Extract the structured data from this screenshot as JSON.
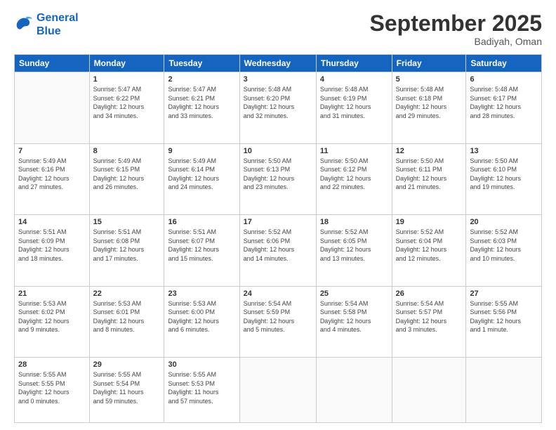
{
  "logo": {
    "line1": "General",
    "line2": "Blue"
  },
  "title": "September 2025",
  "subtitle": "Badiyah, Oman",
  "days_of_week": [
    "Sunday",
    "Monday",
    "Tuesday",
    "Wednesday",
    "Thursday",
    "Friday",
    "Saturday"
  ],
  "weeks": [
    [
      {
        "num": "",
        "info": ""
      },
      {
        "num": "1",
        "info": "Sunrise: 5:47 AM\nSunset: 6:22 PM\nDaylight: 12 hours\nand 34 minutes."
      },
      {
        "num": "2",
        "info": "Sunrise: 5:47 AM\nSunset: 6:21 PM\nDaylight: 12 hours\nand 33 minutes."
      },
      {
        "num": "3",
        "info": "Sunrise: 5:48 AM\nSunset: 6:20 PM\nDaylight: 12 hours\nand 32 minutes."
      },
      {
        "num": "4",
        "info": "Sunrise: 5:48 AM\nSunset: 6:19 PM\nDaylight: 12 hours\nand 31 minutes."
      },
      {
        "num": "5",
        "info": "Sunrise: 5:48 AM\nSunset: 6:18 PM\nDaylight: 12 hours\nand 29 minutes."
      },
      {
        "num": "6",
        "info": "Sunrise: 5:48 AM\nSunset: 6:17 PM\nDaylight: 12 hours\nand 28 minutes."
      }
    ],
    [
      {
        "num": "7",
        "info": "Sunrise: 5:49 AM\nSunset: 6:16 PM\nDaylight: 12 hours\nand 27 minutes."
      },
      {
        "num": "8",
        "info": "Sunrise: 5:49 AM\nSunset: 6:15 PM\nDaylight: 12 hours\nand 26 minutes."
      },
      {
        "num": "9",
        "info": "Sunrise: 5:49 AM\nSunset: 6:14 PM\nDaylight: 12 hours\nand 24 minutes."
      },
      {
        "num": "10",
        "info": "Sunrise: 5:50 AM\nSunset: 6:13 PM\nDaylight: 12 hours\nand 23 minutes."
      },
      {
        "num": "11",
        "info": "Sunrise: 5:50 AM\nSunset: 6:12 PM\nDaylight: 12 hours\nand 22 minutes."
      },
      {
        "num": "12",
        "info": "Sunrise: 5:50 AM\nSunset: 6:11 PM\nDaylight: 12 hours\nand 21 minutes."
      },
      {
        "num": "13",
        "info": "Sunrise: 5:50 AM\nSunset: 6:10 PM\nDaylight: 12 hours\nand 19 minutes."
      }
    ],
    [
      {
        "num": "14",
        "info": "Sunrise: 5:51 AM\nSunset: 6:09 PM\nDaylight: 12 hours\nand 18 minutes."
      },
      {
        "num": "15",
        "info": "Sunrise: 5:51 AM\nSunset: 6:08 PM\nDaylight: 12 hours\nand 17 minutes."
      },
      {
        "num": "16",
        "info": "Sunrise: 5:51 AM\nSunset: 6:07 PM\nDaylight: 12 hours\nand 15 minutes."
      },
      {
        "num": "17",
        "info": "Sunrise: 5:52 AM\nSunset: 6:06 PM\nDaylight: 12 hours\nand 14 minutes."
      },
      {
        "num": "18",
        "info": "Sunrise: 5:52 AM\nSunset: 6:05 PM\nDaylight: 12 hours\nand 13 minutes."
      },
      {
        "num": "19",
        "info": "Sunrise: 5:52 AM\nSunset: 6:04 PM\nDaylight: 12 hours\nand 12 minutes."
      },
      {
        "num": "20",
        "info": "Sunrise: 5:52 AM\nSunset: 6:03 PM\nDaylight: 12 hours\nand 10 minutes."
      }
    ],
    [
      {
        "num": "21",
        "info": "Sunrise: 5:53 AM\nSunset: 6:02 PM\nDaylight: 12 hours\nand 9 minutes."
      },
      {
        "num": "22",
        "info": "Sunrise: 5:53 AM\nSunset: 6:01 PM\nDaylight: 12 hours\nand 8 minutes."
      },
      {
        "num": "23",
        "info": "Sunrise: 5:53 AM\nSunset: 6:00 PM\nDaylight: 12 hours\nand 6 minutes."
      },
      {
        "num": "24",
        "info": "Sunrise: 5:54 AM\nSunset: 5:59 PM\nDaylight: 12 hours\nand 5 minutes."
      },
      {
        "num": "25",
        "info": "Sunrise: 5:54 AM\nSunset: 5:58 PM\nDaylight: 12 hours\nand 4 minutes."
      },
      {
        "num": "26",
        "info": "Sunrise: 5:54 AM\nSunset: 5:57 PM\nDaylight: 12 hours\nand 3 minutes."
      },
      {
        "num": "27",
        "info": "Sunrise: 5:55 AM\nSunset: 5:56 PM\nDaylight: 12 hours\nand 1 minute."
      }
    ],
    [
      {
        "num": "28",
        "info": "Sunrise: 5:55 AM\nSunset: 5:55 PM\nDaylight: 12 hours\nand 0 minutes."
      },
      {
        "num": "29",
        "info": "Sunrise: 5:55 AM\nSunset: 5:54 PM\nDaylight: 11 hours\nand 59 minutes."
      },
      {
        "num": "30",
        "info": "Sunrise: 5:55 AM\nSunset: 5:53 PM\nDaylight: 11 hours\nand 57 minutes."
      },
      {
        "num": "",
        "info": ""
      },
      {
        "num": "",
        "info": ""
      },
      {
        "num": "",
        "info": ""
      },
      {
        "num": "",
        "info": ""
      }
    ]
  ]
}
